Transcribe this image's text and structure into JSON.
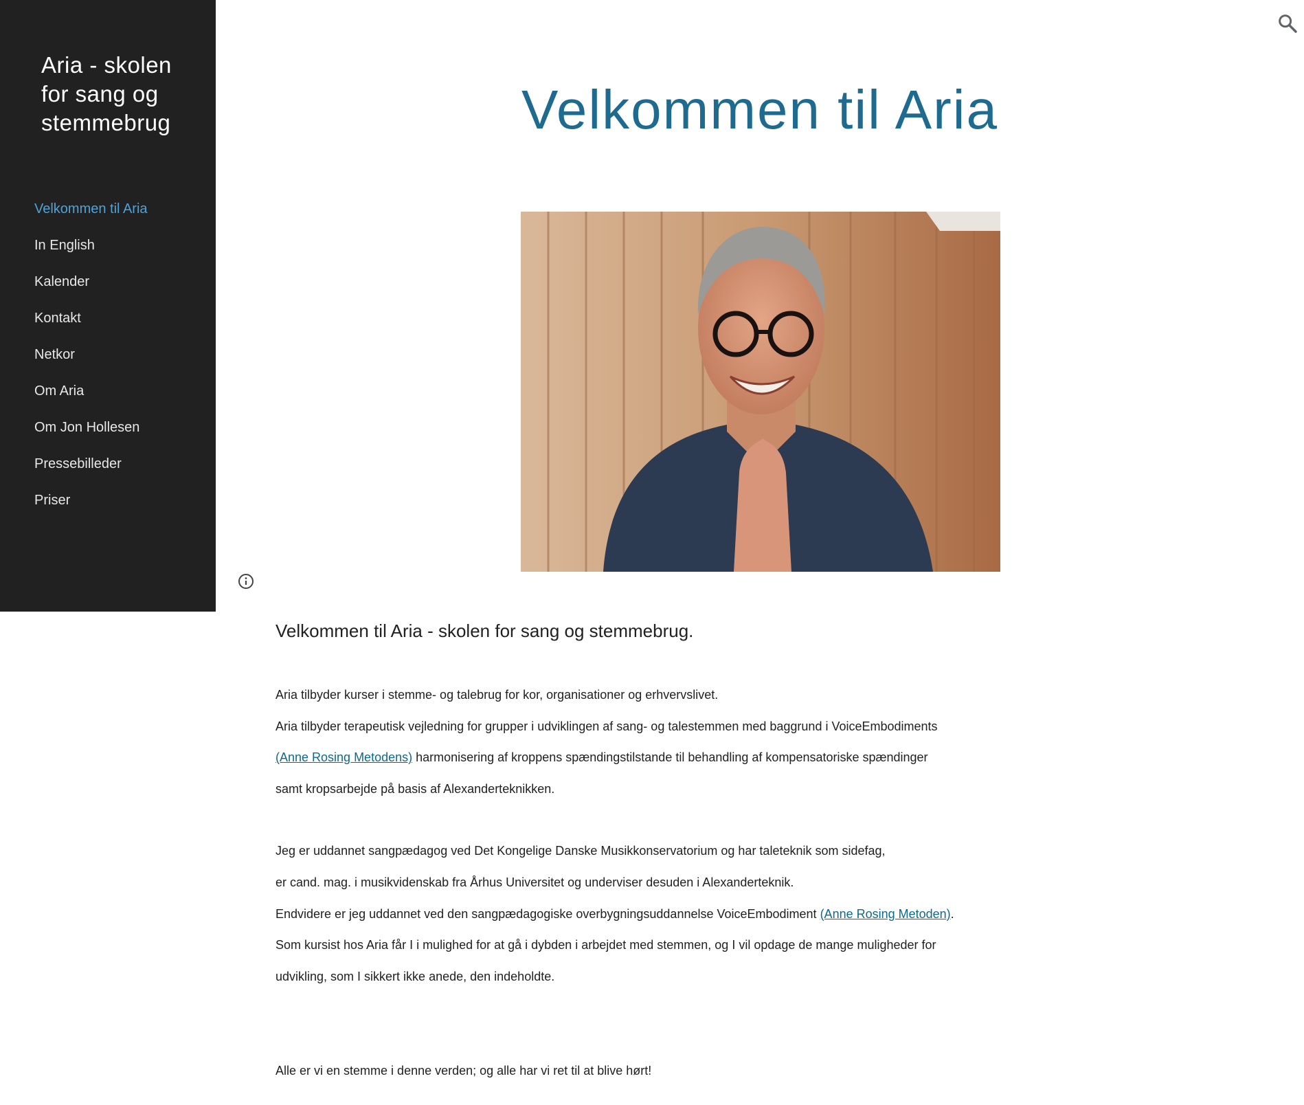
{
  "site": {
    "title": "Aria - skolen for sang og stemmebrug"
  },
  "nav": {
    "items": [
      {
        "label": "Velkommen til Aria",
        "active": true
      },
      {
        "label": "In English"
      },
      {
        "label": "Kalender"
      },
      {
        "label": "Kontakt"
      },
      {
        "label": "Netkor"
      },
      {
        "label": "Om Aria"
      },
      {
        "label": "Om Jon Hollesen"
      },
      {
        "label": "Pressebilleder"
      },
      {
        "label": "Priser"
      }
    ]
  },
  "search": {
    "icon": "search-icon"
  },
  "info": {
    "icon": "info-icon"
  },
  "colors": {
    "sidebar_bg": "#212121",
    "accent": "#4ea3d8",
    "title": "#1f6a8f",
    "link": "#0d6a8a"
  },
  "main": {
    "page_title": "Velkommen til Aria",
    "heading": "Velkommen til Aria - skolen for sang og stemmebrug.",
    "p1": "Aria tilbyder kurser i stemme- og talebrug for kor, organisationer og erhvervslivet.",
    "p2": "Aria tilbyder terapeutisk vejledning for grupper i udviklingen af sang- og talestemmen med baggrund i VoiceEmbodiments",
    "p3_link": "(Anne Rosing Metodens)",
    "p3_rest": " harmonisering af kroppens spændingstilstande til behandling af kompensatoriske spændinger",
    "p4": "samt kropsarbejde på basis af Alexanderteknikken.",
    "p5": "Jeg er uddannet sangpædagog ved Det Kongelige Danske Musikkonservatorium og har taleteknik som sidefag,",
    "p6": "er cand. mag. i musikvidenskab fra Århus Universitet og underviser desuden i Alexanderteknik.",
    "p7_pre": "Endvidere er jeg uddannet ved den sangpædagogiske overbygningsuddannelse VoiceEmbodiment ",
    "p7_link": "(Anne Rosing Metoden)",
    "p7_post": ".",
    "p8": "Som kursist  hos Aria får I  i mulighed for at gå i dybden i arbejdet med  stemmen, og I vil opdage de mange muligheder for",
    "p9": "udvikling, som I sikkert ikke anede, den indeholdte.",
    "p10": "Alle er vi en stemme i denne verden; og alle har vi ret til at blive hørt!"
  }
}
